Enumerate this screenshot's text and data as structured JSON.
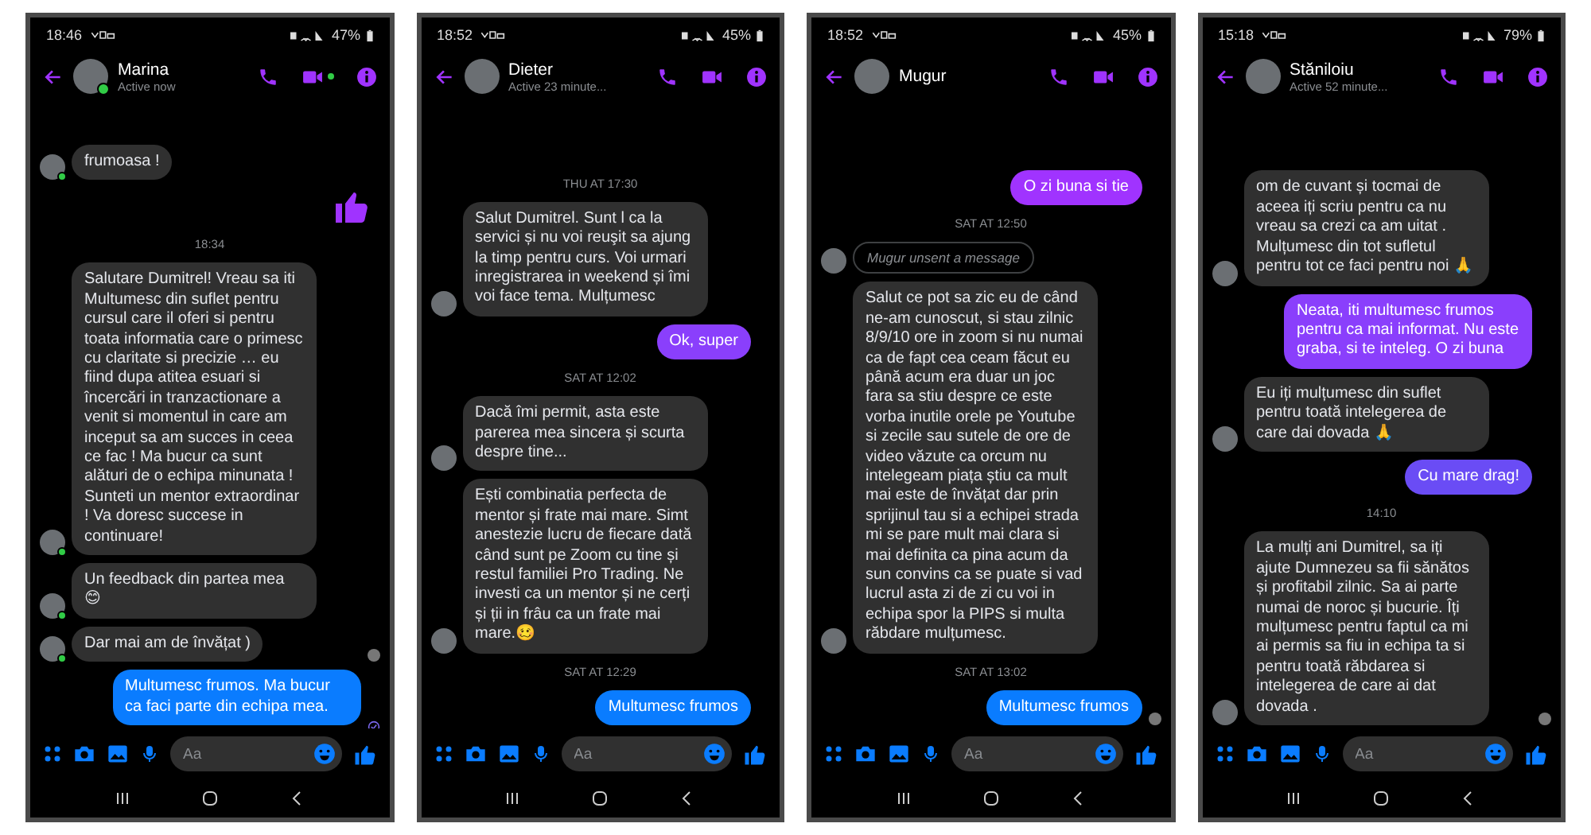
{
  "phones": [
    {
      "status": {
        "time": "18:46",
        "battery": "47%"
      },
      "contact": {
        "name": "Marina",
        "status": "Active now",
        "online": true
      },
      "messages": [
        {
          "kind": "incoming",
          "text": "frumoasa !",
          "avatar": true
        },
        {
          "kind": "like",
          "color": "#a033ff"
        },
        {
          "kind": "timestamp",
          "text": "18:34"
        },
        {
          "kind": "incoming",
          "text": "Salutare Dumitrel! Vreau sa iti Multumesc din suflet pentru cursul care il oferi si pentru toata informatia care o primesc cu claritate si precizie … eu fiind dupa atitea esuari si încercări in tranzactionare a venit si momentul in care am inceput sa am succes in ceea ce fac ! Ma bucur ca sunt alături de o echipa minunata ! Sunteti un mentor extraordinar ! Va doresc succese in continuare!",
          "avatar": true
        },
        {
          "kind": "incoming",
          "text": "Un feedback din partea mea 😊",
          "avatar": true
        },
        {
          "kind": "incoming",
          "text": "Dar mai am de învățat )",
          "avatar": true,
          "seen": true
        },
        {
          "kind": "outgoing",
          "text": "Multumesc frumos.  Ma bucur ca faci parte din echipa mea.",
          "color": "#0a7cff",
          "sent": true
        }
      ],
      "composer": {
        "placeholder": "Aa"
      }
    },
    {
      "status": {
        "time": "18:52",
        "battery": "45%"
      },
      "contact": {
        "name": "Dieter",
        "status": "Active 23 minute...",
        "online": false
      },
      "messages": [
        {
          "kind": "timestamp",
          "text": "THU AT 17:30"
        },
        {
          "kind": "incoming",
          "text": "Salut Dumitrel. Sunt l ca la servici și nu voi reuşit sa ajung la timp pentru curs. Voi urmari inregistrarea in weekend și îmi voi face tema. Mulțumesc",
          "avatar": true
        },
        {
          "kind": "outgoing",
          "text": "Ok, super",
          "color": "#8a3ffc"
        },
        {
          "kind": "timestamp",
          "text": "SAT AT 12:02"
        },
        {
          "kind": "incoming",
          "text": "Dacă îmi permit, asta este parerea mea sincera și scurta despre tine...",
          "avatar": true
        },
        {
          "kind": "incoming",
          "text": "Ești combinatia perfecta de mentor și frate mai mare. Simt anestezie lucru de fiecare dată când sunt pe Zoom cu tine și restul familiei Pro Trading. Ne investi ca un mentor și ne cerți și ții in frâu ca un frate mai mare.🥴",
          "avatar": true
        },
        {
          "kind": "timestamp",
          "text": "SAT AT 12:29"
        },
        {
          "kind": "outgoing",
          "text": "Multumesc frumos",
          "color": "#0a7cff"
        }
      ],
      "composer": {
        "placeholder": "Aa"
      }
    },
    {
      "status": {
        "time": "18:52",
        "battery": "45%"
      },
      "contact": {
        "name": "Mugur",
        "online": false
      },
      "messages": [
        {
          "kind": "outgoing",
          "text": "O zi buna si tie",
          "color": "#a033ff"
        },
        {
          "kind": "timestamp",
          "text": "SAT AT 12:50"
        },
        {
          "kind": "unsent",
          "text": "Mugur unsent a message",
          "avatar": true
        },
        {
          "kind": "incoming",
          "text": "Salut ce pot sa zic eu de când ne-am cunoscut, si stau zilnic 8/9/10 ore in zoom si nu numai ca de fapt cea ceam făcut eu până acum era duar un joc fara sa stiu despre ce este vorba inutile orele pe Youtube si zecile sau sutele de ore de video văzute ca orcum nu intelegeam piața știu ca mult mai este de învățat dar prin sprijinul tau si a echipei strada mi se pare mult mai clara si mai definita ca pina acum da sun convins ca se puate si vad lucrul asta zi de zi cu voi in echipa spor la PIPS si multa răbdare mulțumesc.",
          "avatar": true
        },
        {
          "kind": "timestamp",
          "text": "SAT AT 13:02"
        },
        {
          "kind": "outgoing",
          "text": "Multumesc frumos",
          "color": "#0a7cff",
          "seen": true
        }
      ],
      "composer": {
        "placeholder": "Aa"
      }
    },
    {
      "status": {
        "time": "15:18",
        "battery": "79%"
      },
      "contact": {
        "name": "Stăniloiu",
        "status": "Active 52 minute...",
        "online": false
      },
      "messages": [
        {
          "kind": "incoming",
          "text": "om de cuvant și tocmai de aceea iți scriu pentru ca nu vreau sa crezi ca am uitat . Mulțumesc din tot sufletul pentru tot ce faci pentru noi 🙏",
          "avatar": true
        },
        {
          "kind": "outgoing",
          "text": "Neata, iti multumesc frumos pentru ca mai informat. Nu este graba, si te inteleg. O zi buna",
          "color": "#8a3ffc"
        },
        {
          "kind": "incoming",
          "text": "Eu iți mulțumesc din suflet pentru toată intelegerea de care dai dovada 🙏",
          "avatar": true
        },
        {
          "kind": "outgoing",
          "text": "Cu mare drag!",
          "color": "#6a4cf5"
        },
        {
          "kind": "timestamp",
          "text": "14:10"
        },
        {
          "kind": "incoming",
          "text": "La mulți ani Dumitrel, sa iți ajute Dumnezeu sa fii sănătos și profitabil zilnic. Sa ai parte numai de noroc și bucurie. Îți mulțumesc pentru faptul ca mi ai permis sa fiu in echipa ta si pentru toată răbdarea si intelegerea de care ai dat dovada .",
          "avatar": true,
          "seen": true
        }
      ],
      "composer": {
        "placeholder": "Aa"
      }
    }
  ]
}
